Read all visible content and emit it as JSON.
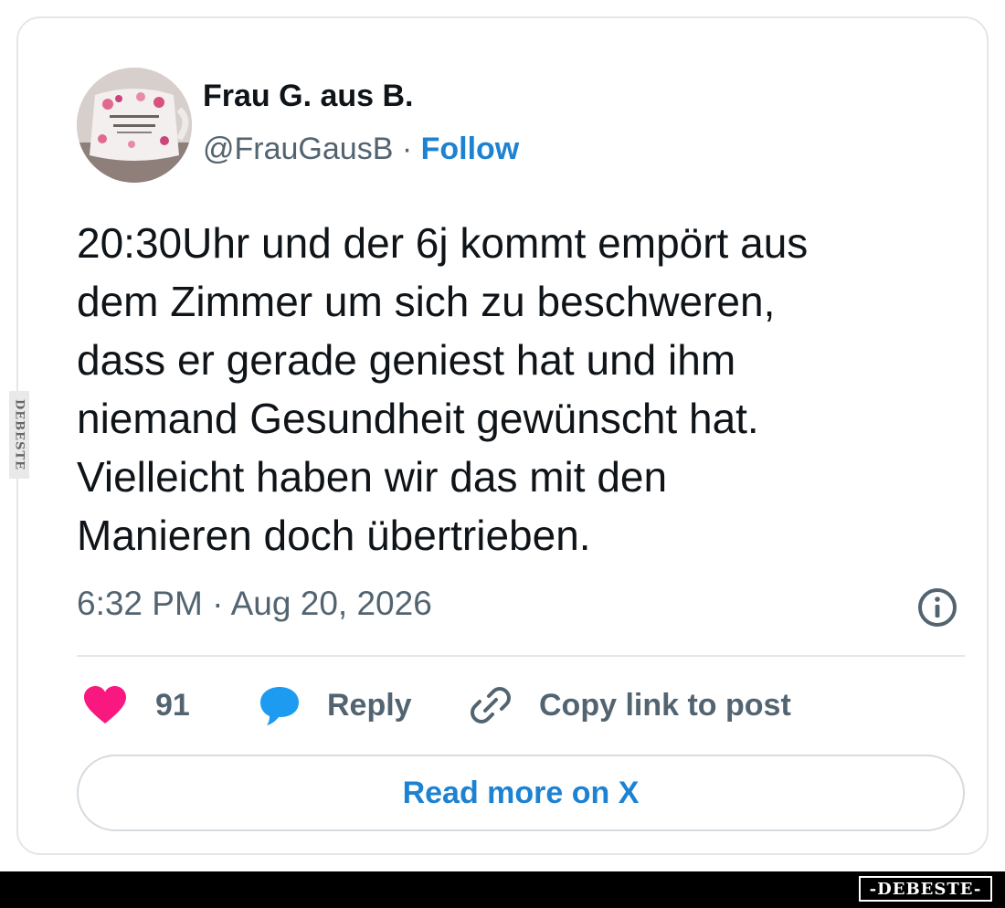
{
  "author": {
    "display_name": "Frau G. aus B.",
    "handle": "@FrauGausB",
    "separator": " · ",
    "follow_label": "Follow"
  },
  "tweet": {
    "lines": [
      "20:30Uhr und der 6j kommt empört aus",
      "dem Zimmer um sich zu beschweren,",
      "dass er gerade geniest hat und ihm",
      "niemand Gesundheit gewünscht hat.",
      "Vielleicht haben wir das mit den",
      "Manieren doch übertrieben."
    ],
    "timestamp": "6:32 PM · Aug 20, 2026"
  },
  "actions": {
    "like_count": "91",
    "reply_label": "Reply",
    "copy_label": "Copy link to post"
  },
  "read_more_label": "Read more on X",
  "colors": {
    "link_blue": "#1d82d2",
    "like_pink": "#f91880",
    "reply_blue": "#1d9bf0",
    "muted_gray": "#536471"
  },
  "icons": [
    "info-icon",
    "heart-icon",
    "reply-bubble-icon",
    "link-icon"
  ]
}
